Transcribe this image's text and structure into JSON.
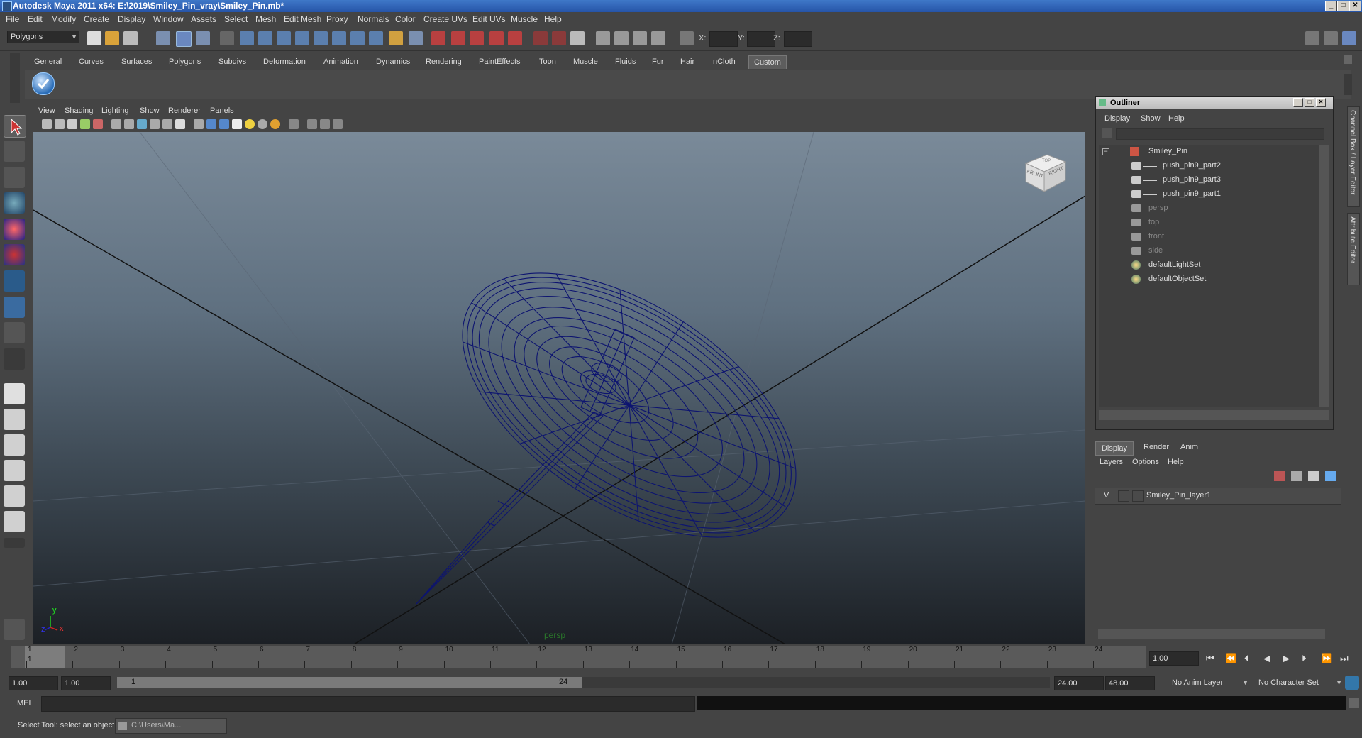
{
  "window": {
    "title": "Autodesk Maya 2011 x64: E:\\2019\\Smiley_Pin_vray\\Smiley_Pin.mb*",
    "min": "_",
    "max": "□",
    "close": "✕"
  },
  "menu": [
    "File",
    "Edit",
    "Modify",
    "Create",
    "Display",
    "Window",
    "Assets",
    "Select",
    "Mesh",
    "Edit Mesh",
    "Proxy",
    "Normals",
    "Color",
    "Create UVs",
    "Edit UVs",
    "Muscle",
    "Help"
  ],
  "statusline": {
    "mode": "Polygons",
    "x_label": "X:",
    "y_label": "Y:",
    "z_label": "Z:"
  },
  "shelf": {
    "tabs": [
      "General",
      "Curves",
      "Surfaces",
      "Polygons",
      "Subdivs",
      "Deformation",
      "Animation",
      "Dynamics",
      "Rendering",
      "PaintEffects",
      "Toon",
      "Muscle",
      "Fluids",
      "Fur",
      "Hair",
      "nCloth",
      "Custom"
    ],
    "active": "Custom"
  },
  "viewport": {
    "menu": [
      "View",
      "Shading",
      "Lighting",
      "Show",
      "Renderer",
      "Panels"
    ],
    "camera_label": "persp",
    "viewcube": {
      "front": "FRONT",
      "right": "RIGHT",
      "top": "TOP"
    },
    "axis": {
      "y": "y",
      "x": "x",
      "z": "z"
    }
  },
  "outliner": {
    "title": "Outliner",
    "menu": [
      "Display",
      "Show",
      "Help"
    ],
    "items": [
      {
        "label": "Smiley_Pin",
        "indent": 0,
        "dim": false,
        "expand": "−"
      },
      {
        "label": "push_pin9_part2",
        "indent": 1,
        "dim": false
      },
      {
        "label": "push_pin9_part3",
        "indent": 1,
        "dim": false
      },
      {
        "label": "push_pin9_part1",
        "indent": 1,
        "dim": false
      },
      {
        "label": "persp",
        "indent": 0,
        "dim": true
      },
      {
        "label": "top",
        "indent": 0,
        "dim": true
      },
      {
        "label": "front",
        "indent": 0,
        "dim": true
      },
      {
        "label": "side",
        "indent": 0,
        "dim": true
      },
      {
        "label": "defaultLightSet",
        "indent": 0,
        "dim": false
      },
      {
        "label": "defaultObjectSet",
        "indent": 0,
        "dim": false
      }
    ]
  },
  "side_tabs": {
    "channel_box": "Channel Box / Layer Editor",
    "attribute_editor": "Attribute Editor"
  },
  "layer_editor": {
    "tabs": [
      "Display",
      "Render",
      "Anim"
    ],
    "active": "Display",
    "menu": [
      "Layers",
      "Options",
      "Help"
    ],
    "layers": [
      {
        "visible": "V",
        "name": "Smiley_Pin_layer1"
      }
    ]
  },
  "timeline": {
    "ticks": [
      "1",
      "2",
      "3",
      "4",
      "5",
      "6",
      "7",
      "8",
      "9",
      "10",
      "11",
      "12",
      "13",
      "14",
      "15",
      "16",
      "17",
      "18",
      "19",
      "20",
      "21",
      "22",
      "23",
      "24"
    ],
    "current_frame_marker": "1",
    "current_time": "1.00"
  },
  "range": {
    "start_time": "1.00",
    "playback_start": "1.00",
    "range_start_label": "1",
    "range_end_label": "24",
    "playback_end": "24.00",
    "end_time": "48.00",
    "anim_layer": "No Anim Layer",
    "character_set": "No Character Set"
  },
  "command": {
    "label": "MEL"
  },
  "help": {
    "text": "Select Tool: select an object",
    "script_task": "C:\\Users\\Ma..."
  },
  "colors": {
    "wireframe": "#0d1470",
    "accent": "#3f78c8"
  }
}
